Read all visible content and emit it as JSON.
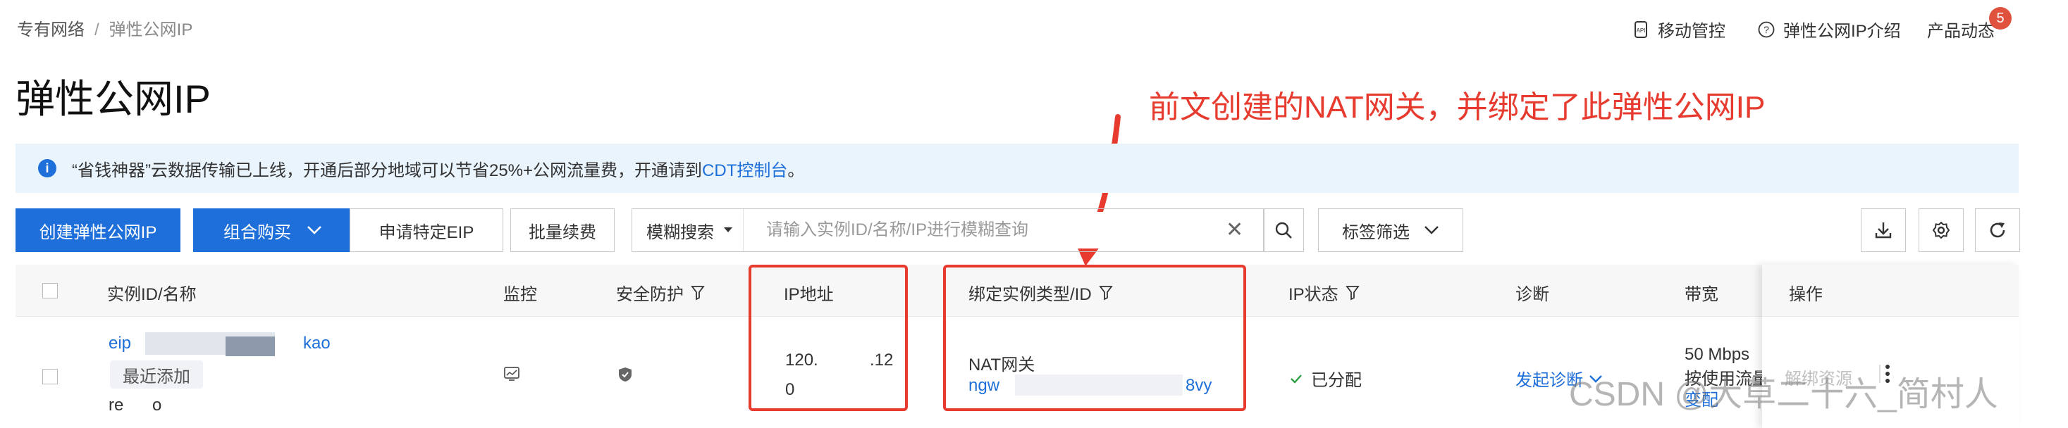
{
  "breadcrumb": {
    "root": "专有网络",
    "separator": "/",
    "current": "弹性公网IP"
  },
  "top_links": {
    "mobile": "移动管控",
    "intro": "弹性公网IP介绍",
    "news": "产品动态",
    "news_badge": "5"
  },
  "page_title": "弹性公网IP",
  "annotation": "前文创建的NAT网关，并绑定了此弹性公网IP",
  "notice": {
    "text_before": "“省钱神器”云数据传输已上线，开通后部分地域可以节省25%+公网流量费，开通请到",
    "link": "CDT控制台",
    "text_after": "。"
  },
  "toolbar": {
    "create": "创建弹性公网IP",
    "combo": "组合购买",
    "special": "申请特定EIP",
    "renew": "批量续费",
    "search_mode": "模糊搜索",
    "search_placeholder": "请输入实例ID/名称/IP进行模糊查询",
    "tag_filter": "标签筛选"
  },
  "table": {
    "headers": {
      "instance": "实例ID/名称",
      "monitor": "监控",
      "security": "安全防护",
      "ip": "IP地址",
      "binding": "绑定实例类型/ID",
      "status": "IP状态",
      "diagnose": "诊断",
      "bandwidth": "带宽",
      "actions": "操作"
    },
    "row": {
      "id_prefix": "eip",
      "id_suffix": "kao",
      "tag": "最近添加",
      "name_prefix": "re",
      "name_suffix": "o",
      "ip_part1": "120.",
      "ip_part2": ".12",
      "ip_part3": "0",
      "bind_type": "NAT网关",
      "bind_id_prefix": "ngw",
      "bind_id_suffix": "8vy",
      "status": "已分配",
      "diagnose": "发起诊断",
      "bandwidth": "50 Mbps",
      "billing": "按使用流量",
      "change": "变配",
      "unbind": "解绑资源"
    }
  },
  "watermark": "CSDN @大草二十六_简村人",
  "colors": {
    "primary": "#1e6fd9",
    "annotation": "#e63b2e",
    "status_ok": "#2ea043"
  }
}
